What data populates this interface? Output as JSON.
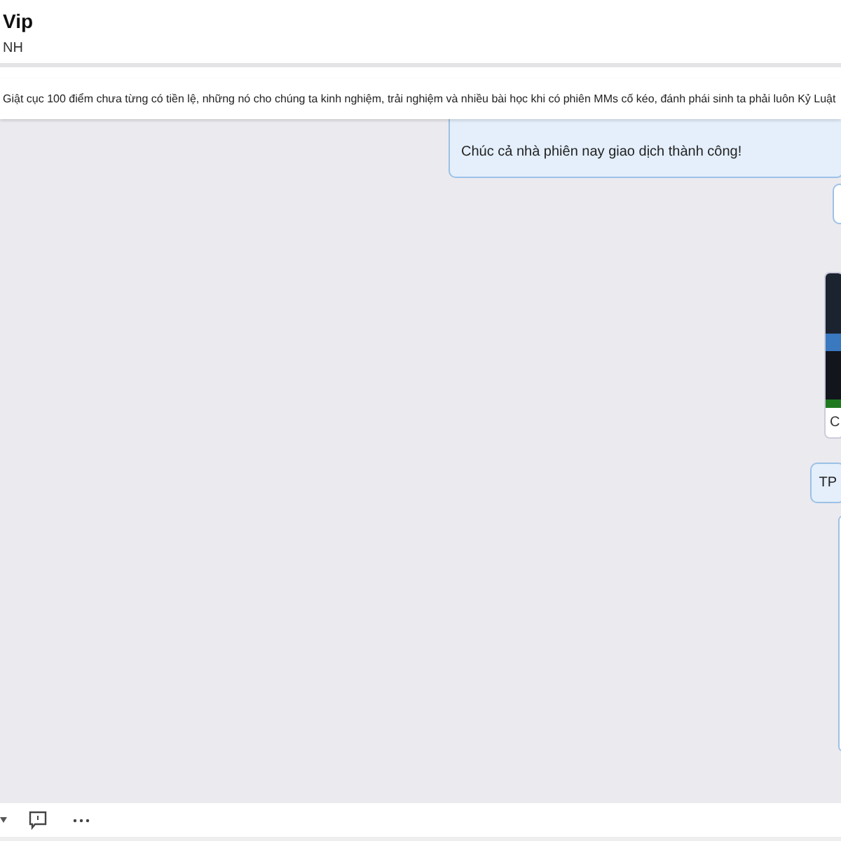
{
  "header": {
    "title": "Vip",
    "subtitle": "NH"
  },
  "pinned_message": {
    "text": "Giật cục 100 điểm chưa từng có tiền lệ, những nó cho chúng ta kinh nghiệm, trải nghiệm và nhiều bài học khi có phiên MMs cố kéo, đánh phái sinh ta phải luôn Kỷ Luật"
  },
  "messages": [
    {
      "kind": "text",
      "text": "Chúc cả nhà phiên nay giao dịch thành công!"
    },
    {
      "kind": "blank"
    },
    {
      "kind": "image",
      "caption": "C"
    },
    {
      "kind": "text",
      "text": "TP"
    },
    {
      "kind": "tall"
    }
  ]
}
